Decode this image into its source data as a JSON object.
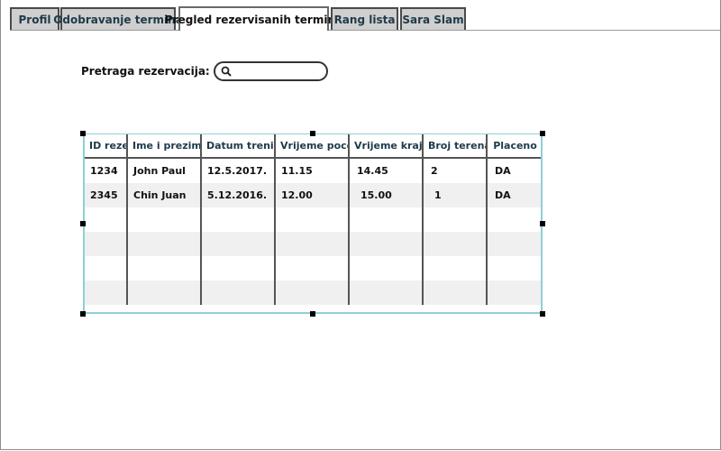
{
  "tabs": [
    {
      "label": "Profil",
      "active": false
    },
    {
      "label": "Odobravanje termina",
      "active": false
    },
    {
      "label": "Pregled rezervisanih termina",
      "active": true
    },
    {
      "label": "Rang lista",
      "active": false
    },
    {
      "label": "Sara Slam",
      "active": false
    }
  ],
  "search": {
    "label": "Pretraga rezervacija:",
    "value": "",
    "icon": "search-icon"
  },
  "table": {
    "columns": [
      "ID rezervacije",
      "Ime i prezime",
      "Datum treninga",
      "Vrijeme pocetka",
      "Vrijeme kraja",
      "Broj terena",
      "Placeno"
    ],
    "rows": [
      [
        "1234",
        "John Paul",
        "12.5.2017.",
        "11.15",
        "14.45",
        "2",
        "DA"
      ],
      [
        "2345",
        "Chin Juan",
        "5.12.2016.",
        "12.00",
        "15.00",
        "1",
        "DA"
      ],
      [
        "",
        "",
        "",
        "",
        "",
        "",
        ""
      ],
      [
        "",
        "",
        "",
        "",
        "",
        "",
        ""
      ],
      [
        "",
        "",
        "",
        "",
        "",
        "",
        ""
      ],
      [
        "",
        "",
        "",
        "",
        "",
        "",
        ""
      ]
    ]
  }
}
